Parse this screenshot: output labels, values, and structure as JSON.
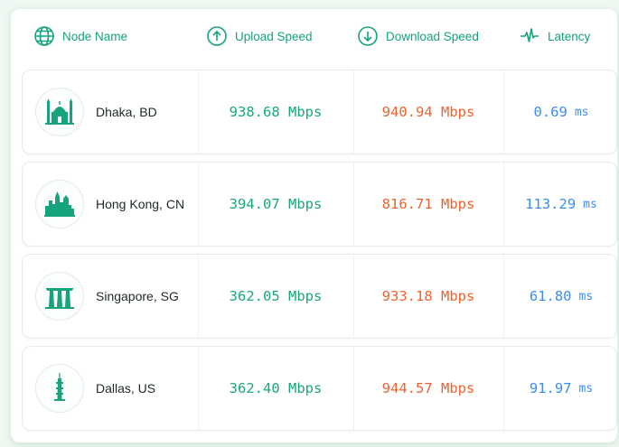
{
  "header": {
    "node_label": "Node Name",
    "upload_label": "Upload Speed",
    "download_label": "Download Speed",
    "latency_label": "Latency"
  },
  "rows": [
    {
      "node": "Dhaka, BD",
      "icon": "mosque-icon",
      "upload": "938.68 Mbps",
      "download": "940.94 Mbps",
      "latency": "0.69",
      "latency_unit": "ms"
    },
    {
      "node": "Hong Kong, CN",
      "icon": "skyline-icon",
      "upload": "394.07 Mbps",
      "download": "816.71 Mbps",
      "latency": "113.29",
      "latency_unit": "ms"
    },
    {
      "node": "Singapore, SG",
      "icon": "marina-bay-icon",
      "upload": "362.05 Mbps",
      "download": "933.18 Mbps",
      "latency": "61.80",
      "latency_unit": "ms"
    },
    {
      "node": "Dallas, US",
      "icon": "tower-icon",
      "upload": "362.40 Mbps",
      "download": "944.57 Mbps",
      "latency": "91.97",
      "latency_unit": "ms"
    }
  ],
  "colors": {
    "accent": "#14a37f",
    "upload": "#19a87a",
    "download": "#f0622d",
    "latency": "#3a8ef2"
  }
}
